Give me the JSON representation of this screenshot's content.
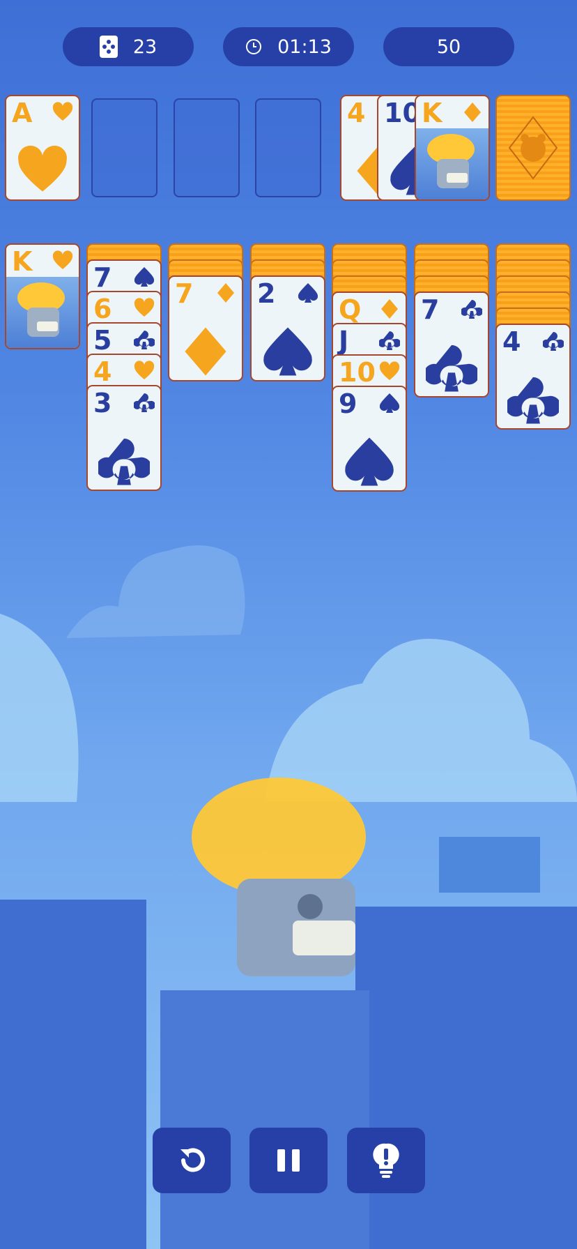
{
  "hud": {
    "moves": "23",
    "timer": "01:13",
    "score": "50"
  },
  "icons": {
    "moves": "dice-icon",
    "timer": "clock-icon",
    "undo": "undo-icon",
    "pause": "pause-icon",
    "hint": "lightbulb-hint-icon"
  },
  "colors": {
    "hud_bg": "#2640a8",
    "card_face": "#eef5f9",
    "card_border": "#a4472c",
    "red_suit": "#f6a51e",
    "black_suit": "#2a3ea0",
    "card_back": "#f7a018"
  },
  "foundation": [
    {
      "rank": "A",
      "suit": "hearts"
    },
    {
      "rank": "",
      "suit": ""
    },
    {
      "rank": "",
      "suit": ""
    },
    {
      "rank": "",
      "suit": ""
    }
  ],
  "waste": [
    {
      "rank": "4",
      "suit": "diamonds"
    },
    {
      "rank": "10",
      "suit": "spades"
    },
    {
      "rank": "K",
      "suit": "diamonds"
    }
  ],
  "tableau": [
    {
      "face_down": 0,
      "cards": [
        {
          "rank": "K",
          "suit": "hearts"
        }
      ]
    },
    {
      "face_down": 1,
      "cards": [
        {
          "rank": "7",
          "suit": "spades"
        },
        {
          "rank": "6",
          "suit": "hearts"
        },
        {
          "rank": "5",
          "suit": "clubs"
        },
        {
          "rank": "4",
          "suit": "hearts"
        },
        {
          "rank": "3",
          "suit": "clubs"
        }
      ]
    },
    {
      "face_down": 2,
      "cards": [
        {
          "rank": "7",
          "suit": "diamonds"
        }
      ]
    },
    {
      "face_down": 2,
      "cards": [
        {
          "rank": "2",
          "suit": "spades"
        }
      ]
    },
    {
      "face_down": 3,
      "cards": [
        {
          "rank": "Q",
          "suit": "diamonds"
        },
        {
          "rank": "J",
          "suit": "clubs"
        },
        {
          "rank": "10",
          "suit": "hearts"
        },
        {
          "rank": "9",
          "suit": "spades"
        }
      ]
    },
    {
      "face_down": 3,
      "cards": [
        {
          "rank": "7",
          "suit": "clubs"
        }
      ]
    },
    {
      "face_down": 5,
      "cards": [
        {
          "rank": "4",
          "suit": "clubs"
        }
      ]
    }
  ]
}
